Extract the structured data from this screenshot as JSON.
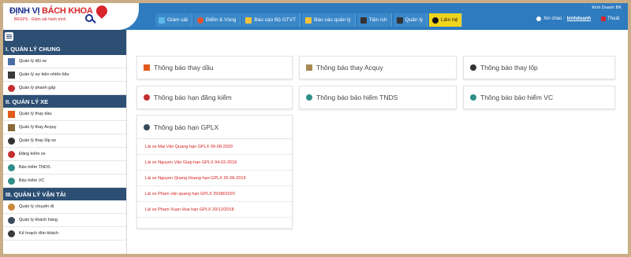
{
  "header": {
    "logo_title_a": "ĐỊNH VỊ ",
    "logo_title_b": "BÁCH KHOA",
    "logo_subtitle": "BKGPS - Giám sát hành trình",
    "company": "Kinh Doanh BK",
    "greeting": "Xin chào :",
    "username": "kinhdoanh",
    "logout": "Thoát",
    "nav": [
      {
        "label": "Giám sát",
        "icon": "monitor-icon",
        "color": "#5bb7e8"
      },
      {
        "label": "Điểm & Vùng",
        "icon": "map-marker-icon",
        "color": "#e8542a"
      },
      {
        "label": "Báo cáo Bộ GTVT",
        "icon": "truck-icon",
        "color": "#f3c23a"
      },
      {
        "label": "Báo cáo quản lý",
        "icon": "truck-report-icon",
        "color": "#f3c23a"
      },
      {
        "label": "Tiện ích",
        "icon": "utility-icon",
        "color": "#333333"
      },
      {
        "label": "Quản lý",
        "icon": "management-icon",
        "color": "#333333"
      },
      {
        "label": "Liên hệ",
        "icon": "phone-icon",
        "color": "#111111"
      }
    ]
  },
  "sidebar": {
    "section1": {
      "title": "I. QUẢN LÝ CHUNG",
      "items": [
        {
          "label": "Quản lý đội xe",
          "icon": "fleet-icon",
          "color": "#4a6fa5"
        },
        {
          "label": "Quản lý sự kiện nhiên liệu",
          "icon": "fuel-event-icon",
          "color": "#3a3a3a"
        },
        {
          "label": "Quản lý phanh gấp",
          "icon": "brake-icon",
          "color": "#c43030"
        }
      ]
    },
    "section2": {
      "title": "II. QUẢN LÝ XE",
      "items": [
        {
          "label": "Quản lý thay dầu",
          "icon": "oil-change-icon",
          "color": "#e25b1d"
        },
        {
          "label": "Quản lý thay Acquy",
          "icon": "battery-icon",
          "color": "#8a6a3a"
        },
        {
          "label": "Quản lý thay lốp xe",
          "icon": "tire-icon",
          "color": "#333333"
        },
        {
          "label": "Đăng kiểm xe",
          "icon": "inspection-icon",
          "color": "#c43030"
        },
        {
          "label": "Bảo hiểm TNDS",
          "icon": "insurance-tnds-icon",
          "color": "#2f8f88"
        },
        {
          "label": "Bảo hiểm VC",
          "icon": "insurance-vc-icon",
          "color": "#2f8f88"
        }
      ]
    },
    "section3": {
      "title": "III. QUẢN LÝ VẬN TẢI",
      "items": [
        {
          "label": "Quản lý chuyến đi",
          "icon": "trip-icon",
          "color": "#c9873a"
        },
        {
          "label": "Quản lý khách hàng",
          "icon": "customer-icon",
          "color": "#3a4a5a"
        },
        {
          "label": "Kế hoạch đón khách",
          "icon": "pickup-plan-icon",
          "color": "#3a3a3a"
        }
      ]
    }
  },
  "cards": [
    {
      "label": "Thông báo thay dầu",
      "icon": "oil-change-icon",
      "color": "#e25b1d"
    },
    {
      "label": "Thông báo thay Acquy",
      "icon": "battery-icon",
      "color": "#a88a55"
    },
    {
      "label": "Thông báo thay lốp",
      "icon": "tire-icon",
      "color": "#333333"
    },
    {
      "label": "Thông báo hạn đăng kiểm",
      "icon": "inspection-icon",
      "color": "#c43030"
    },
    {
      "label": "Thông báo bảo hiểm TNDS",
      "icon": "insurance-tnds-icon",
      "color": "#2f8f88"
    },
    {
      "label": "Thông báo bảo hiểm VC",
      "icon": "insurance-vc-icon",
      "color": "#2f8f88"
    }
  ],
  "gplx": {
    "title": "Thông báo hạn GPLX",
    "rows": [
      "Lái xe Mai Văn Quang hạn GPLX 09-08-2020",
      "Lái xe Nguyen Văn Giap hạn GPLX 04-02-2018",
      "Lái xe Nguyen Quang Hoang hạn GPLX 25-06-2019",
      "Lái xe Pham văn quang hạn GPLX 25/08/2020",
      "Lái xe Pham Xuan Hoa hạn GPLX 20/12/2018"
    ]
  }
}
